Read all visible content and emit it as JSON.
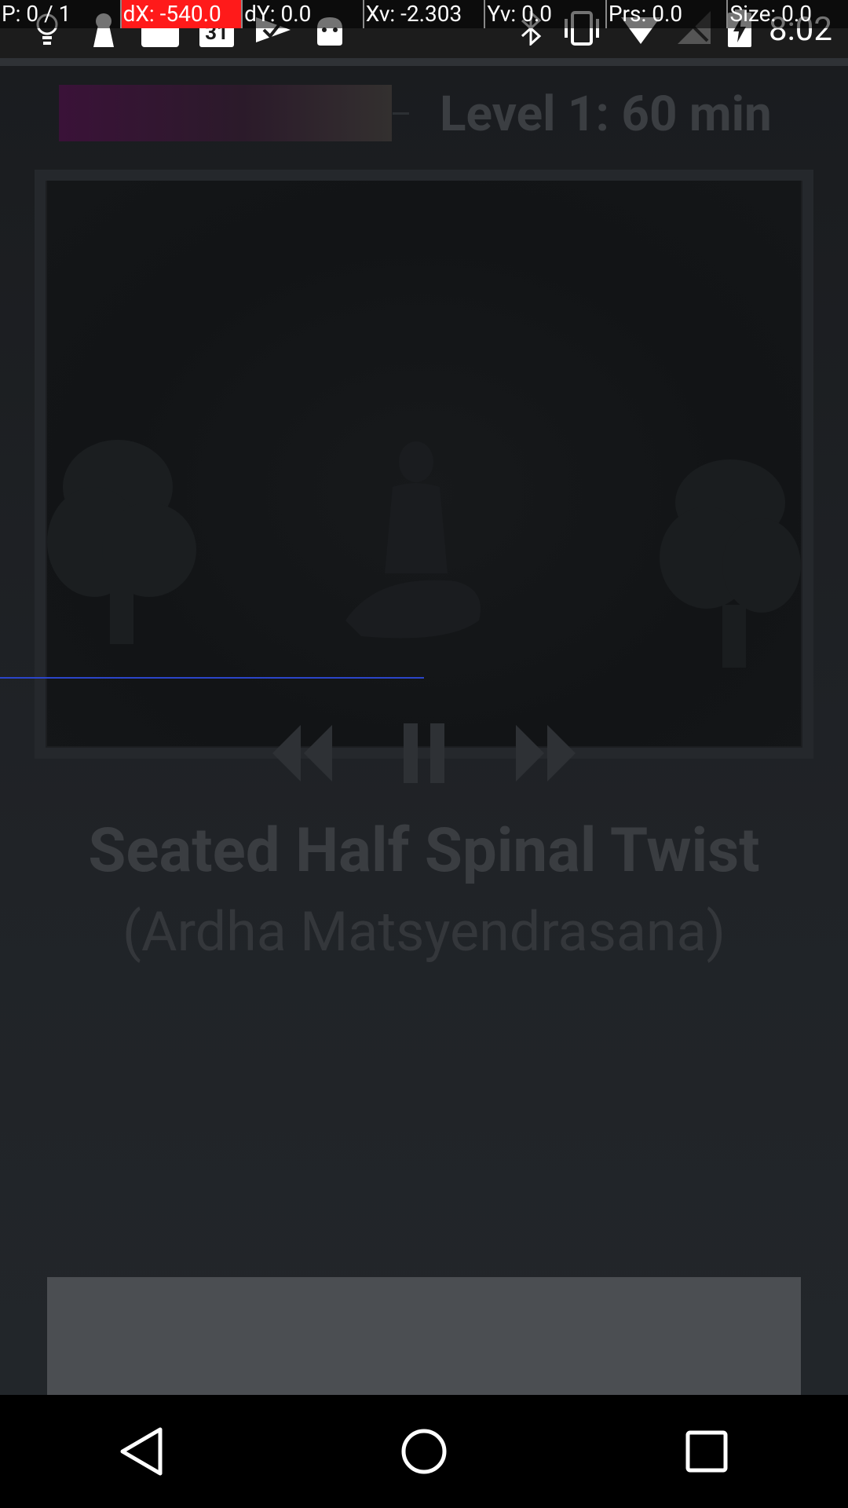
{
  "pointer_overlay": {
    "cells": [
      "P: 0 / 1",
      "dX: -540.0",
      "dY: 0.0",
      "Xv: -2.303",
      "Yv: 0.0",
      "Prs: 0.0",
      "Size: 0.0"
    ],
    "highlight_index": 1
  },
  "status_bar": {
    "left_icons": [
      "lightbulb-icon",
      "keyhole-icon",
      "blank-card-icon",
      "calendar-icon",
      "check-icon",
      "android-icon"
    ],
    "calendar_date": "31",
    "right_icons": [
      "bluetooth-icon",
      "vibrate-icon",
      "wifi-icon",
      "no-signal-icon",
      "battery-charging-icon"
    ],
    "time": "8:02"
  },
  "session": {
    "level_label": "Level 1: 60 min",
    "progress_fraction": 0.95
  },
  "video": {
    "scrub_position_fraction": 0.5
  },
  "controls": {
    "rewind_icon": "rewind-icon",
    "pause_icon": "pause-icon",
    "fast_forward_icon": "fast-forward-icon"
  },
  "pose": {
    "title": "Seated Half Spinal Twist",
    "subtitle": "(Ardha Matsyendrasana)"
  },
  "nav": {
    "icons": [
      "back-icon",
      "home-icon",
      "recents-icon"
    ]
  },
  "colors": {
    "background": "#202327",
    "progress_accent": "#3a1238",
    "scrub_line": "#2b45c9",
    "overlay_highlight": "#ff1a1a"
  }
}
